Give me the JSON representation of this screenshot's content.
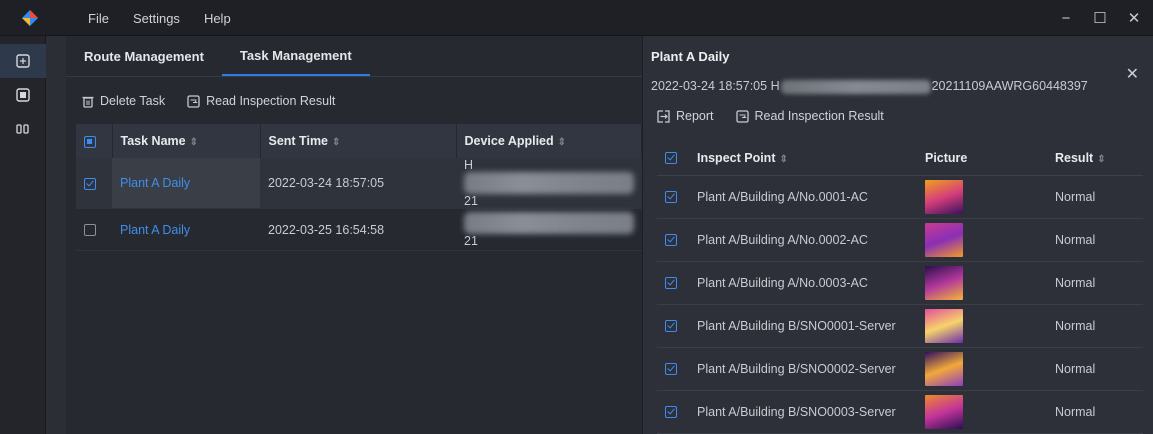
{
  "menu": {
    "file": "File",
    "settings": "Settings",
    "help": "Help"
  },
  "window_controls": {
    "minimize": "−",
    "maximize": "☐",
    "close": "✕"
  },
  "tabs": [
    {
      "label": "Route Management",
      "active": false
    },
    {
      "label": "Task Management",
      "active": true
    }
  ],
  "toolbar": {
    "delete": "Delete Task",
    "read": "Read Inspection Result"
  },
  "task_table": {
    "headers": {
      "name": "Task Name",
      "sent": "Sent Time",
      "device": "Device Applied"
    },
    "rows": [
      {
        "name": "Plant A Daily",
        "sent": "2022-03-24 18:57:05",
        "device_prefix": "H",
        "device_suffix": "21",
        "checked": true
      },
      {
        "name": "Plant A Daily",
        "sent": "2022-03-25 16:54:58",
        "device_prefix": "",
        "device_suffix": "21",
        "checked": false
      }
    ]
  },
  "panel": {
    "title": "Plant A Daily",
    "subtitle_time": "2022-03-24 18:57:05",
    "subtitle_prefix": "H",
    "subtitle_suffix": "20211109AAWRG60448397",
    "close": "✕",
    "tools": {
      "report": "Report",
      "read": "Read Inspection Result"
    },
    "headers": {
      "point": "Inspect Point",
      "picture": "Picture",
      "result": "Result"
    },
    "rows": [
      {
        "point": "Plant A/Building A/No.0001-AC",
        "result": "Normal",
        "thumb": [
          "#f0a01c",
          "#d53f7a",
          "#3a1060"
        ]
      },
      {
        "point": "Plant A/Building A/No.0002-AC",
        "result": "Normal",
        "thumb": [
          "#c93c92",
          "#8a2fb5",
          "#f09a2a"
        ]
      },
      {
        "point": "Plant A/Building A/No.0003-AC",
        "result": "Normal",
        "thumb": [
          "#2a0f4d",
          "#b1389b",
          "#f3b53a"
        ]
      },
      {
        "point": "Plant A/Building B/SNO0001-Server",
        "result": "Normal",
        "thumb": [
          "#e64f9b",
          "#f6d36a",
          "#6b2bb0"
        ]
      },
      {
        "point": "Plant A/Building B/SNO0002-Server",
        "result": "Normal",
        "thumb": [
          "#301060",
          "#f2a83a",
          "#8e3cc0"
        ]
      },
      {
        "point": "Plant A/Building B/SNO0003-Server",
        "result": "Normal",
        "thumb": [
          "#ef8a2a",
          "#c4359a",
          "#2a0f55"
        ]
      }
    ]
  },
  "colors": {
    "accent": "#2e7de2",
    "link": "#3f8fe8",
    "bg": "#2b2e35"
  }
}
